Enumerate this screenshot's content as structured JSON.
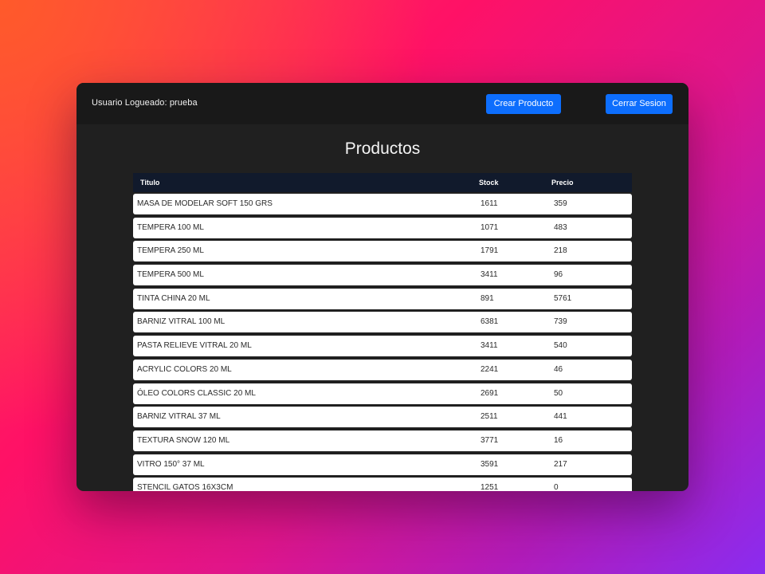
{
  "header": {
    "user_label": "Usuario Logueado: prueba",
    "create_button": "Crear Producto",
    "logout_button": "Cerrar Sesion"
  },
  "main": {
    "title": "Productos",
    "columns": [
      "Titulo",
      "Stock",
      "Precio"
    ],
    "rows": [
      {
        "titulo": "MASA DE MODELAR SOFT 150 GRS",
        "stock": "1611",
        "precio": "359"
      },
      {
        "titulo": "TEMPERA 100 ML",
        "stock": "1071",
        "precio": "483"
      },
      {
        "titulo": "TEMPERA 250 ML",
        "stock": "1791",
        "precio": "218"
      },
      {
        "titulo": "TEMPERA 500 ML",
        "stock": "3411",
        "precio": "96"
      },
      {
        "titulo": "TINTA CHINA 20 ML",
        "stock": "891",
        "precio": "5761"
      },
      {
        "titulo": "BARNIZ VITRAL 100 ML",
        "stock": "6381",
        "precio": "739"
      },
      {
        "titulo": "PASTA RELIEVE VITRAL 20 ML",
        "stock": "3411",
        "precio": "540"
      },
      {
        "titulo": "ACRYLIC COLORS 20 ML",
        "stock": "2241",
        "precio": "46"
      },
      {
        "titulo": "ÓLEO COLORS CLASSIC 20 ML",
        "stock": "2691",
        "precio": "50"
      },
      {
        "titulo": "BARNIZ VITRAL 37 ML",
        "stock": "2511",
        "precio": "441"
      },
      {
        "titulo": "TEXTURA SNOW 120 ML",
        "stock": "3771",
        "precio": "16"
      },
      {
        "titulo": "VITRO 150° 37 ML",
        "stock": "3591",
        "precio": "217"
      },
      {
        "titulo": "STENCIL GATOS 16X3CM",
        "stock": "1251",
        "precio": "0"
      }
    ]
  },
  "colors": {
    "primary_button": "#0d6efd",
    "window_background": "#202020",
    "topbar_background": "#191919",
    "table_header_background": "#111a2c"
  }
}
